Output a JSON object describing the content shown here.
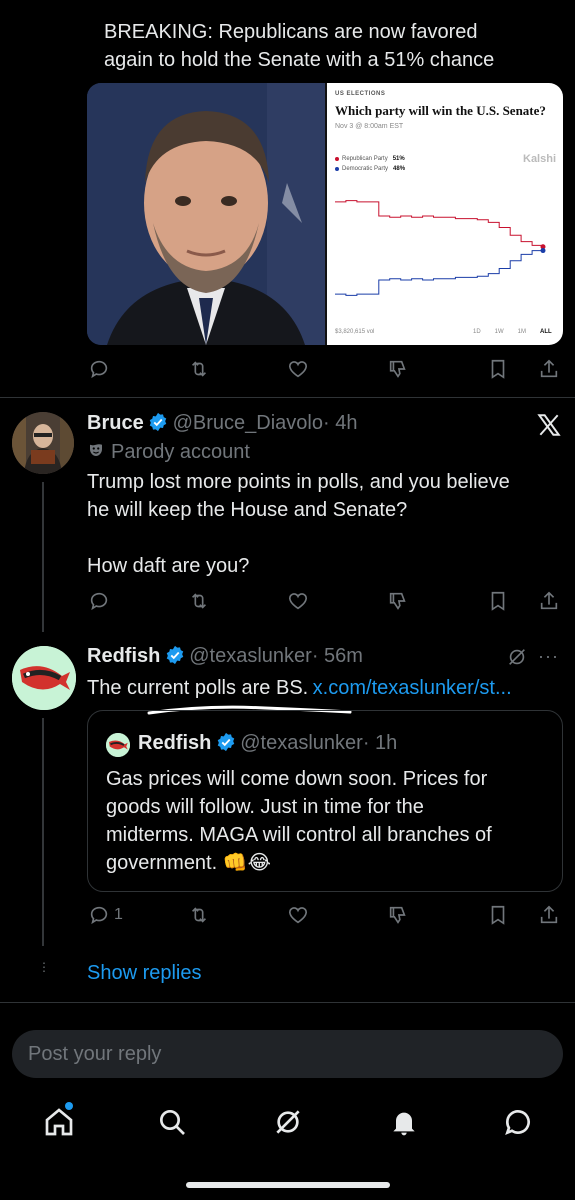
{
  "top_tweet": {
    "text_line1": "BREAKING: Republicans are now favored",
    "text_line2": "again to hold the Senate with a 51% chance",
    "chart_card": {
      "kicker": "US ELECTIONS",
      "title": "Which party will win the U.S. Senate?",
      "date": "Nov 3 @ 8:00am EST",
      "brand": "Kalshi",
      "legend_rep": "Republican Party",
      "legend_rep_val": "51%",
      "legend_dem": "Democratic Party",
      "legend_dem_val": "48%",
      "volume": "$3,820,615 vol",
      "ranges": [
        "1D",
        "1W",
        "1M",
        "ALL"
      ]
    },
    "colors": {
      "rep": "#c8102e",
      "dem": "#1a3da8"
    }
  },
  "chart_data": {
    "type": "line",
    "title": "Which party will win the U.S. Senate?",
    "series": [
      {
        "name": "Republican Party",
        "values": [
          86,
          87,
          86,
          86,
          75,
          74,
          75,
          74,
          75,
          74,
          74,
          73,
          73,
          72,
          70,
          66,
          60,
          55,
          52,
          51
        ]
      },
      {
        "name": "Democratic Party",
        "values": [
          14,
          13,
          14,
          14,
          25,
          26,
          25,
          26,
          25,
          26,
          26,
          27,
          27,
          28,
          30,
          34,
          40,
          45,
          48,
          48
        ]
      }
    ],
    "ylim": [
      0,
      100
    ]
  },
  "bruce_tweet": {
    "name": "Bruce",
    "handle": "@Bruce_Diavolo",
    "time": "· 4h",
    "parody": "Parody account",
    "line1": "Trump lost more points in polls, and you believe",
    "line2": "he will keep the House and Senate?",
    "line3": "How daft are you?"
  },
  "redfish_tweet": {
    "name": "Redfish",
    "handle": "@texaslunker",
    "time": "· 56m",
    "text": "The current polls are BS.",
    "link": "x.com/texaslunker/st...",
    "reply_count": "1",
    "quote": {
      "name": "Redfish",
      "handle": "@texaslunker",
      "time": "· 1h",
      "line1": "Gas prices will come down soon. Prices for",
      "line2": "goods will follow. Just in time for the",
      "line3": "midterms. MAGA will control all branches of",
      "line4": "government. 👊😂"
    }
  },
  "show_replies": "Show replies",
  "reply_box": {
    "placeholder": "Post your reply"
  },
  "nav": [
    "home-icon",
    "search-icon",
    "grok-icon",
    "notifications-icon",
    "messages-icon"
  ]
}
